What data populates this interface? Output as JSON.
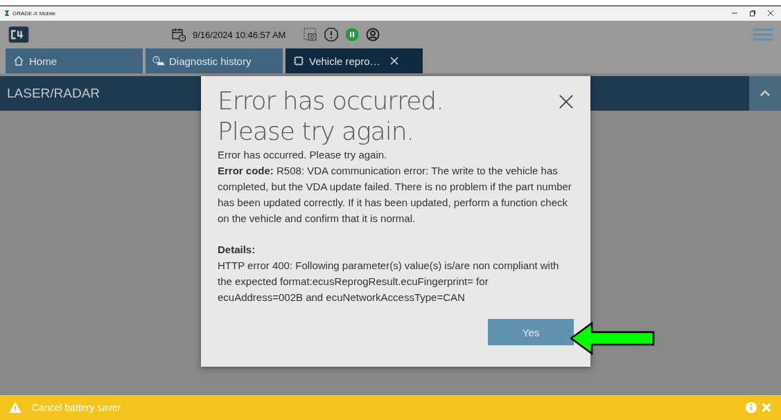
{
  "window": {
    "title": "GRADE-X Mobile"
  },
  "header": {
    "datetime": "9/16/2024 10:46:57 AM",
    "pause_on": true
  },
  "tabs": [
    {
      "label": "Home",
      "kind": "home",
      "selected": false,
      "closable": false
    },
    {
      "label": "Diagnostic history",
      "kind": "history",
      "selected": false,
      "closable": false
    },
    {
      "label": "Vehicle repro…",
      "kind": "chip",
      "selected": true,
      "closable": true
    }
  ],
  "section": {
    "title": "LASER/RADAR",
    "expanded": true
  },
  "dialog": {
    "title_lines": [
      "Error has occurred.",
      "Please try again."
    ],
    "message": "Error has occurred. Please try again.",
    "error_text": "**Error code:** R508: VDA communication error: The write to the vehicle has completed, but the VDA update failed. There is no problem if the part number has been updated correctly. If it has been updated, perform a function check on the vehicle and confirm that it is normal.",
    "details_label": "Details:",
    "details": "HTTP error 400: Following parameter(s) value(s) is/are non compliant with the expected format:ecusReprogResult.ecuFingerprint= for ecuAddress=002B and ecuNetworkAccessType=CAN",
    "button": "Yes"
  },
  "status_bar": {
    "text": "Cancel battery saver"
  }
}
